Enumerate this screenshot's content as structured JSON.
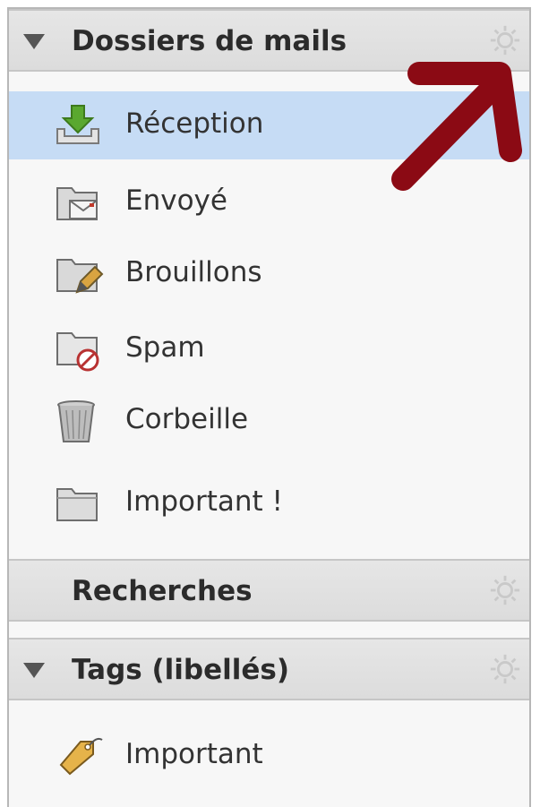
{
  "sections": {
    "folders": {
      "title": "Dossiers de mails",
      "items": [
        {
          "label": "Réception",
          "icon": "inbox-icon"
        },
        {
          "label": "Envoyé",
          "icon": "sent-folder-icon"
        },
        {
          "label": "Brouillons",
          "icon": "drafts-folder-icon"
        },
        {
          "label": "Spam",
          "icon": "spam-folder-icon"
        },
        {
          "label": "Corbeille",
          "icon": "trash-icon"
        },
        {
          "label": "Important !",
          "icon": "folder-icon"
        }
      ]
    },
    "searches": {
      "title": "Recherches"
    },
    "tags": {
      "title": "Tags (libellés)",
      "items": [
        {
          "label": "Important",
          "icon": "tag-icon"
        }
      ]
    }
  },
  "colors": {
    "selected_row": "#c6dcf5",
    "header_bg": "#e0e0e0",
    "annotation_arrow": "#8b0a14"
  }
}
